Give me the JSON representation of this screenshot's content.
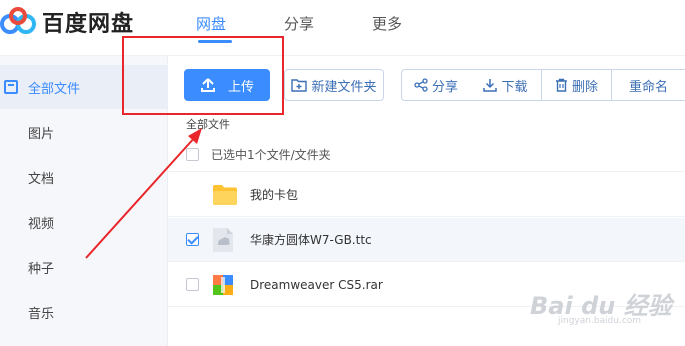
{
  "header": {
    "logo_text": "百度网盘",
    "tabs": [
      {
        "label": "网盘",
        "active": true
      },
      {
        "label": "分享",
        "active": false
      },
      {
        "label": "更多",
        "active": false
      }
    ]
  },
  "sidebar": {
    "items": [
      {
        "label": "全部文件",
        "active": true
      },
      {
        "label": "图片"
      },
      {
        "label": "文档"
      },
      {
        "label": "视频"
      },
      {
        "label": "种子"
      },
      {
        "label": "音乐"
      }
    ]
  },
  "toolbar": {
    "upload": "上传",
    "new_folder": "新建文件夹",
    "share": "分享",
    "download": "下载",
    "delete": "删除",
    "rename": "重命名"
  },
  "breadcrumb": "全部文件",
  "file_list": {
    "selection_status": "已选中1个文件/文件夹",
    "rows": [
      {
        "name": "我的卡包",
        "type": "folder",
        "checked": false
      },
      {
        "name": "华康方圆体W7-GB.ttc",
        "type": "font-file",
        "checked": true
      },
      {
        "name": "Dreamweaver CS5.rar",
        "type": "archive",
        "checked": false
      }
    ]
  },
  "watermark": {
    "main": "Bai du 经验",
    "sub": "jingyan.baidu.com"
  },
  "colors": {
    "accent": "#3b8cff",
    "annotation": "#e8262b"
  }
}
